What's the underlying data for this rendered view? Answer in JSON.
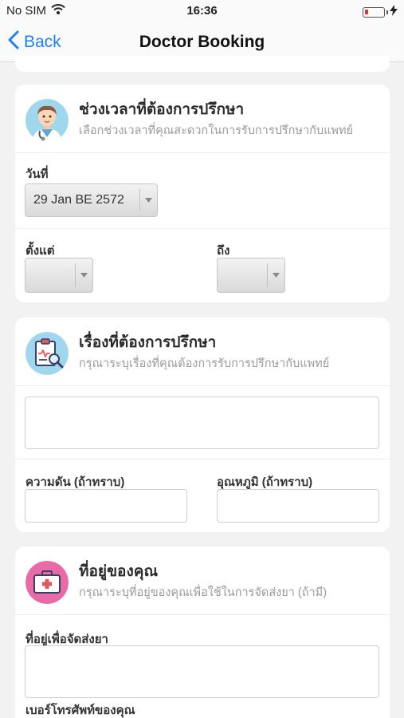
{
  "status": {
    "carrier": "No SIM",
    "time": "16:36",
    "charging_icon": "bolt-icon",
    "battery_color": "#e0303a"
  },
  "nav": {
    "back_label": "Back",
    "title": "Doctor Booking",
    "accent": "#1a82fb"
  },
  "time_card": {
    "title": "ช่วงเวลาที่ต้องการปรึกษา",
    "subtitle": "เลือกช่วงเวลาที่คุณสะดวกในการรับการปรึกษากับแพทย์",
    "date_label": "วันที่",
    "date_value": "29 Jan BE 2572",
    "from_label": "ตั้งแต่",
    "from_value": "",
    "to_label": "ถึง",
    "to_value": ""
  },
  "topic_card": {
    "title": "เรื่องที่ต้องการปรึกษา",
    "subtitle": "กรุณาระบุเรื่องที่คุณต้องการรับการปรึกษากับแพทย์",
    "topic_value": "",
    "pressure_label": "ความดัน (ถ้าทราบ)",
    "pressure_value": "",
    "temperature_label": "อุณหภูมิ (ถ้าทราบ)",
    "temperature_value": ""
  },
  "address_card": {
    "title": "ที่อยู่ของคุณ",
    "subtitle": "กรุณาระบุที่อยู่ของคุณเพื่อใช้ในการจัดส่งยา (ถ้ามี)",
    "address_label": "ที่อยู่เพื่อจัดส่งยา",
    "address_value": "",
    "phone_label": "เบอร์โทรศัพท์ของคุณ"
  }
}
